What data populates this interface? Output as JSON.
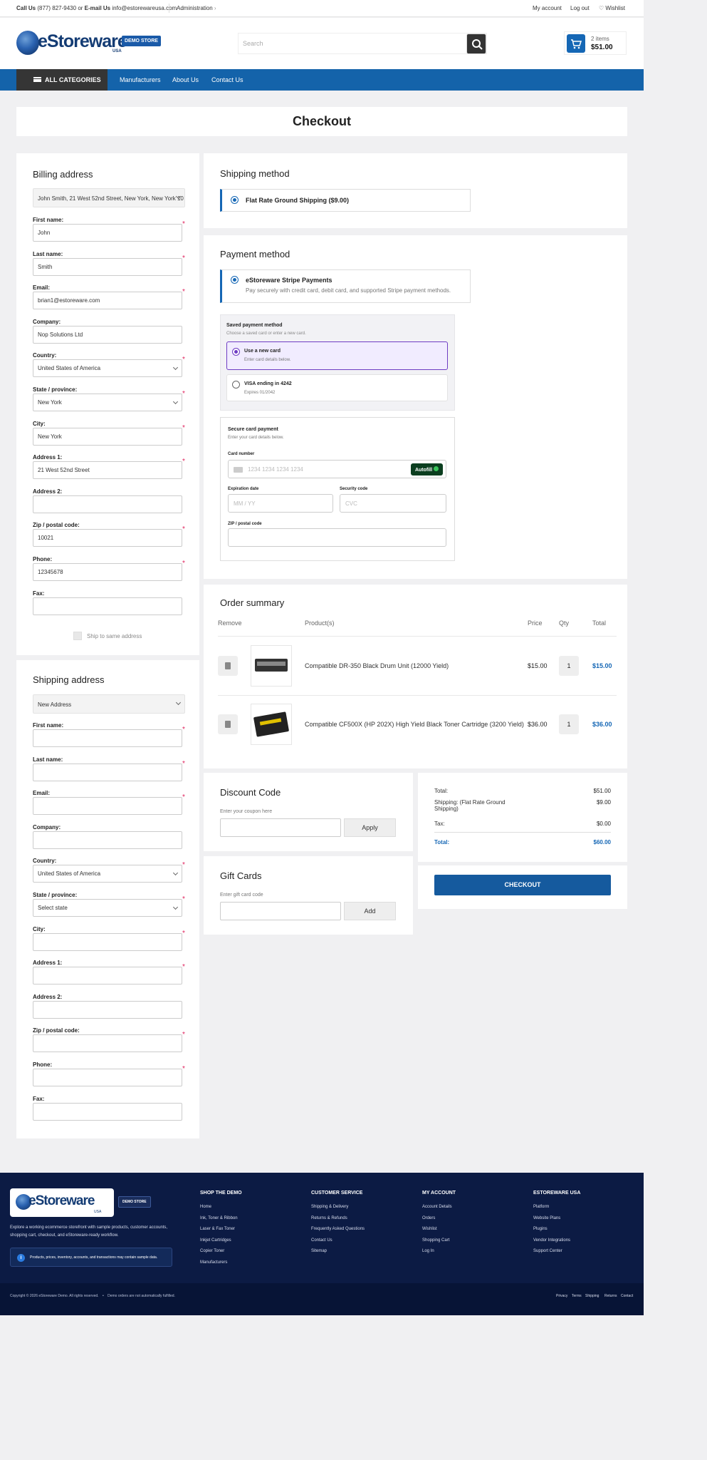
{
  "topbar": {
    "call_label": "Call Us",
    "phone": "(877) 827-9430",
    "or": "or",
    "email_label": "E-mail Us",
    "email": "info@estorewareusa.com",
    "admin": "Administration",
    "admin_chev": "›",
    "my_account": "My account",
    "log_out": "Log out",
    "wishlist": "Wishlist"
  },
  "header": {
    "logo_text": "eStoreware",
    "logo_sub": "USA",
    "demo_badge": "DEMO STORE",
    "search_placeholder": "Search",
    "cart_items": "2 items",
    "cart_total": "$51.00"
  },
  "nav": {
    "all_categories": "ALL CATEGORIES",
    "links": [
      "Manufacturers",
      "About Us",
      "Contact Us"
    ]
  },
  "page_title": "Checkout",
  "billing": {
    "title": "Billing address",
    "select": "John Smith, 21 West 52nd Street, New York, New York 10",
    "fields": [
      {
        "label": "First name:",
        "value": "John",
        "req": true,
        "type": "text"
      },
      {
        "label": "Last name:",
        "value": "Smith",
        "req": true,
        "type": "text"
      },
      {
        "label": "Email:",
        "value": "brian1@estoreware.com",
        "req": true,
        "type": "text"
      },
      {
        "label": "Company:",
        "value": "Nop Solutions Ltd",
        "req": false,
        "type": "text"
      },
      {
        "label": "Country:",
        "value": "United States of America",
        "req": true,
        "type": "select"
      },
      {
        "label": "State / province:",
        "value": "New York",
        "req": true,
        "type": "select"
      },
      {
        "label": "City:",
        "value": "New York",
        "req": true,
        "type": "text"
      },
      {
        "label": "Address 1:",
        "value": "21 West 52nd Street",
        "req": true,
        "type": "text"
      },
      {
        "label": "Address 2:",
        "value": "",
        "req": false,
        "type": "text"
      },
      {
        "label": "Zip / postal code:",
        "value": "10021",
        "req": true,
        "type": "text"
      },
      {
        "label": "Phone:",
        "value": "12345678",
        "req": true,
        "type": "text"
      },
      {
        "label": "Fax:",
        "value": "",
        "req": false,
        "type": "text"
      }
    ],
    "ship_same": "Ship to same address"
  },
  "shipping_addr": {
    "title": "Shipping address",
    "select": "New Address",
    "fields": [
      {
        "label": "First name:",
        "value": "",
        "req": true,
        "type": "text"
      },
      {
        "label": "Last name:",
        "value": "",
        "req": true,
        "type": "text"
      },
      {
        "label": "Email:",
        "value": "",
        "req": true,
        "type": "text"
      },
      {
        "label": "Company:",
        "value": "",
        "req": false,
        "type": "text"
      },
      {
        "label": "Country:",
        "value": "United States of America",
        "req": true,
        "type": "select"
      },
      {
        "label": "State / province:",
        "value": "Select state",
        "req": true,
        "type": "select"
      },
      {
        "label": "City:",
        "value": "",
        "req": true,
        "type": "text"
      },
      {
        "label": "Address 1:",
        "value": "",
        "req": true,
        "type": "text"
      },
      {
        "label": "Address 2:",
        "value": "",
        "req": false,
        "type": "text"
      },
      {
        "label": "Zip / postal code:",
        "value": "",
        "req": true,
        "type": "text"
      },
      {
        "label": "Phone:",
        "value": "",
        "req": true,
        "type": "text"
      },
      {
        "label": "Fax:",
        "value": "",
        "req": false,
        "type": "text"
      }
    ]
  },
  "shipping_method": {
    "title": "Shipping method",
    "option": "Flat Rate Ground Shipping ($9.00)"
  },
  "payment": {
    "title": "Payment method",
    "option": "eStoreware Stripe Payments",
    "desc": "Pay securely with credit card, debit card, and supported Stripe payment methods.",
    "saved_title": "Saved payment method",
    "saved_sub": "Choose a saved card or enter a new card.",
    "new_card": "Use a new card",
    "new_card_sub": "Enter card details below.",
    "visa": "VISA ending in 4242",
    "visa_sub": "Expires 01/2042",
    "secure_title": "Secure card payment",
    "secure_sub": "Enter your card details below.",
    "card_number_label": "Card number",
    "card_number_ph": "1234 1234 1234 1234",
    "autofill": "Autofill",
    "exp_label": "Expiration date",
    "exp_ph": "MM / YY",
    "cvc_label": "Security code",
    "cvc_ph": "CVC",
    "zip_label": "ZIP / postal code"
  },
  "order": {
    "title": "Order summary",
    "headers": [
      "Remove",
      "Product(s)",
      "Price",
      "Qty",
      "Total"
    ],
    "rows": [
      {
        "name": "Compatible DR-350 Black Drum Unit (12000 Yield)",
        "price": "$15.00",
        "qty": "1",
        "total": "$15.00"
      },
      {
        "name": "Compatible CF500X (HP 202X) High Yield Black Toner Cartridge (3200 Yield)",
        "price": "$36.00",
        "qty": "1",
        "total": "$36.00"
      }
    ]
  },
  "discount": {
    "title": "Discount Code",
    "hint": "Enter your coupon here",
    "button": "Apply"
  },
  "gift": {
    "title": "Gift Cards",
    "hint": "Enter gift card code",
    "button": "Add"
  },
  "totals": {
    "subtotal_label": "Total:",
    "subtotal": "$51.00",
    "shipping_label": "Shipping: (Flat Rate Ground Shipping)",
    "shipping": "$9.00",
    "tax_label": "Tax:",
    "tax": "$0.00",
    "total_label": "Total:",
    "total": "$60.00",
    "checkout": "CHECKOUT"
  },
  "footer": {
    "logo_text": "eStoreware",
    "logo_sub": "USA",
    "demo_badge": "DEMO STORE",
    "about": "Explore a working ecommerce storefront with sample products, customer accounts, shopping cart, checkout, and eStoreware-ready workflow.",
    "notice": "Products, prices, inventory, accounts, and transactions may contain sample data.",
    "cols": [
      {
        "title": "SHOP THE DEMO",
        "links": [
          "Home",
          "Ink, Toner & Ribbon",
          "Laser & Fax Toner",
          "Inkjet Cartridges",
          "Copier Toner",
          "Manufacturers"
        ]
      },
      {
        "title": "CUSTOMER SERVICE",
        "links": [
          "Shipping & Delivery",
          "Returns & Refunds",
          "Frequently Asked Questions",
          "Contact Us",
          "Sitemap"
        ]
      },
      {
        "title": "MY ACCOUNT",
        "links": [
          "Account Details",
          "Orders",
          "Wishlist",
          "Shopping Cart",
          "Log In"
        ]
      },
      {
        "title": "ESTOREWARE USA",
        "links": [
          "Platform",
          "Website Plans",
          "Plugins",
          "Vendor Integrations",
          "Support Center"
        ]
      }
    ],
    "copyright": "Copyright © 2026 eStoreware Demo. All rights reserved.",
    "dot": "•",
    "demo_note": "Demo orders are not automatically fulfilled.",
    "bottom_links": [
      "Privacy",
      "Terms",
      "Shipping",
      "Returns",
      "Contact"
    ]
  },
  "colors": {
    "primary": "#1463aa",
    "dark": "#0c1b44",
    "accent_text": "#1567b5",
    "required": "#e0245e"
  }
}
